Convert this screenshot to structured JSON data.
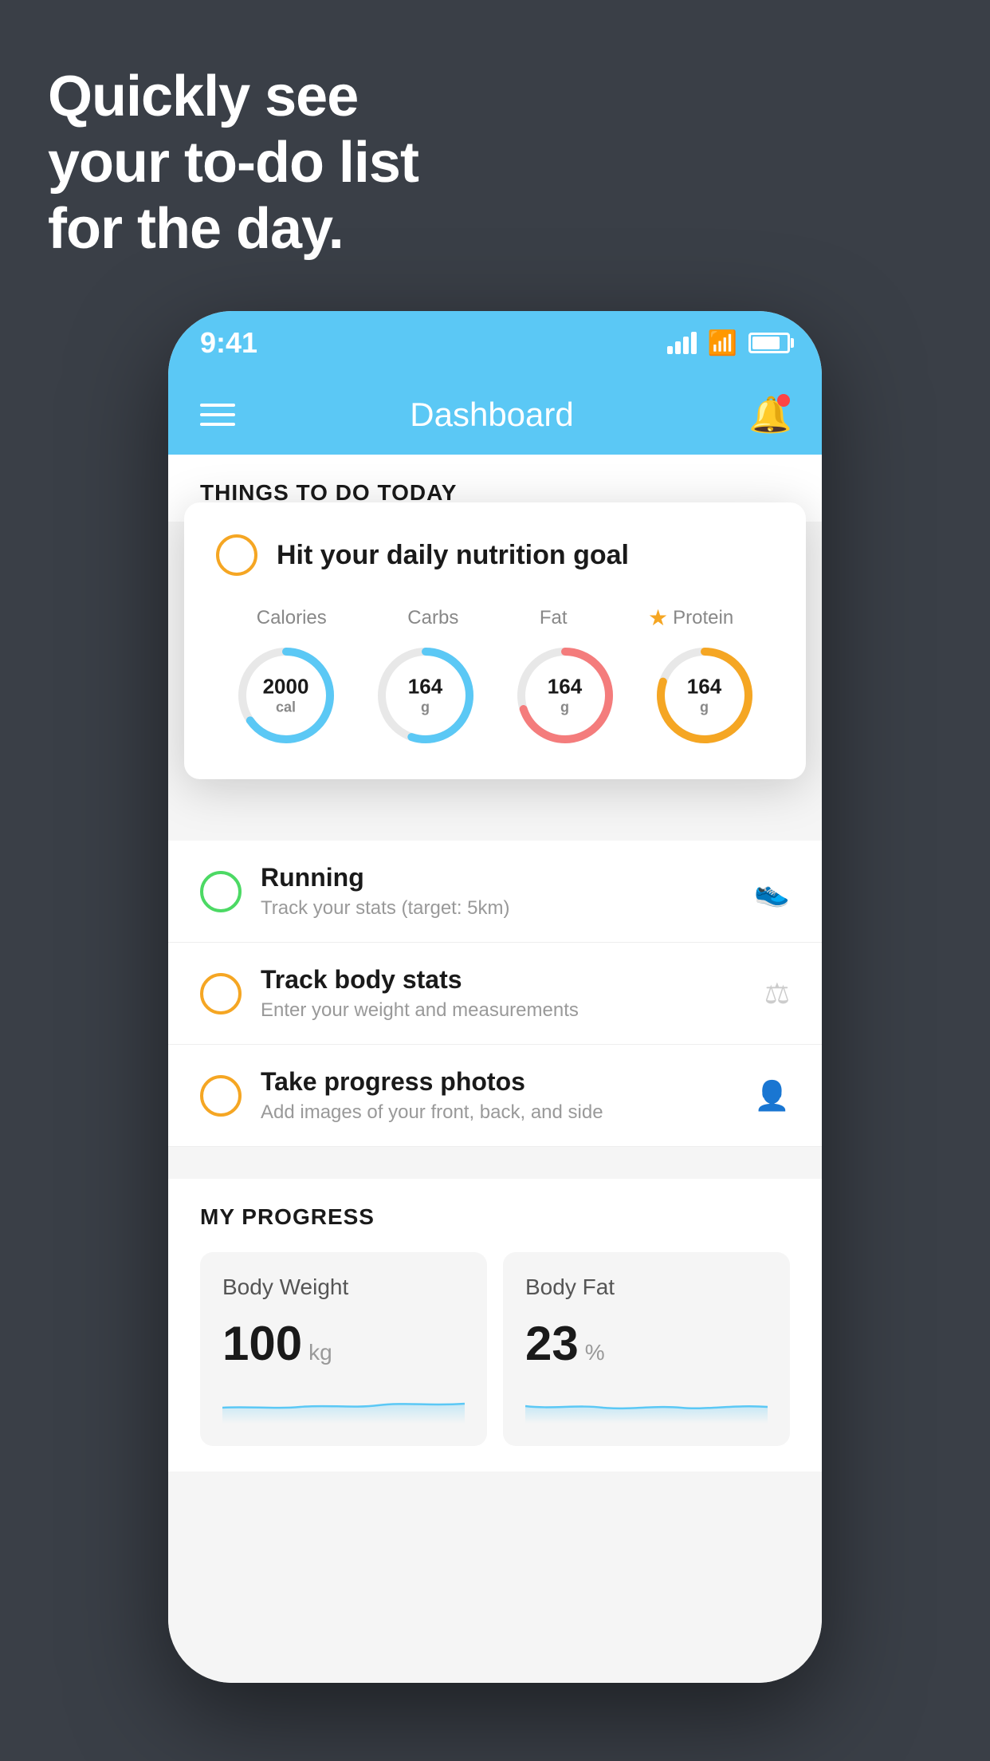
{
  "hero": {
    "line1": "Quickly see",
    "line2": "your to-do list",
    "line3": "for the day."
  },
  "status_bar": {
    "time": "9:41"
  },
  "nav": {
    "title": "Dashboard"
  },
  "things_to_do": {
    "section_title": "THINGS TO DO TODAY"
  },
  "nutrition_card": {
    "task_title": "Hit your daily nutrition goal",
    "labels": [
      "Calories",
      "Carbs",
      "Fat",
      "Protein"
    ],
    "values": [
      {
        "num": "2000",
        "unit": "cal",
        "color": "#5bc8f5",
        "pct": 65
      },
      {
        "num": "164",
        "unit": "g",
        "color": "#5bc8f5",
        "pct": 55
      },
      {
        "num": "164",
        "unit": "g",
        "color": "#f47c7c",
        "pct": 70
      },
      {
        "num": "164",
        "unit": "g",
        "color": "#f5a623",
        "pct": 80
      }
    ]
  },
  "todo_items": [
    {
      "title": "Running",
      "subtitle": "Track your stats (target: 5km)",
      "icon": "👟",
      "checkbox_color": "green"
    },
    {
      "title": "Track body stats",
      "subtitle": "Enter your weight and measurements",
      "icon": "⚖",
      "checkbox_color": "yellow"
    },
    {
      "title": "Take progress photos",
      "subtitle": "Add images of your front, back, and side",
      "icon": "👤",
      "checkbox_color": "yellow"
    }
  ],
  "progress": {
    "section_title": "MY PROGRESS",
    "cards": [
      {
        "title": "Body Weight",
        "value": "100",
        "unit": "kg"
      },
      {
        "title": "Body Fat",
        "value": "23",
        "unit": "%"
      }
    ]
  }
}
